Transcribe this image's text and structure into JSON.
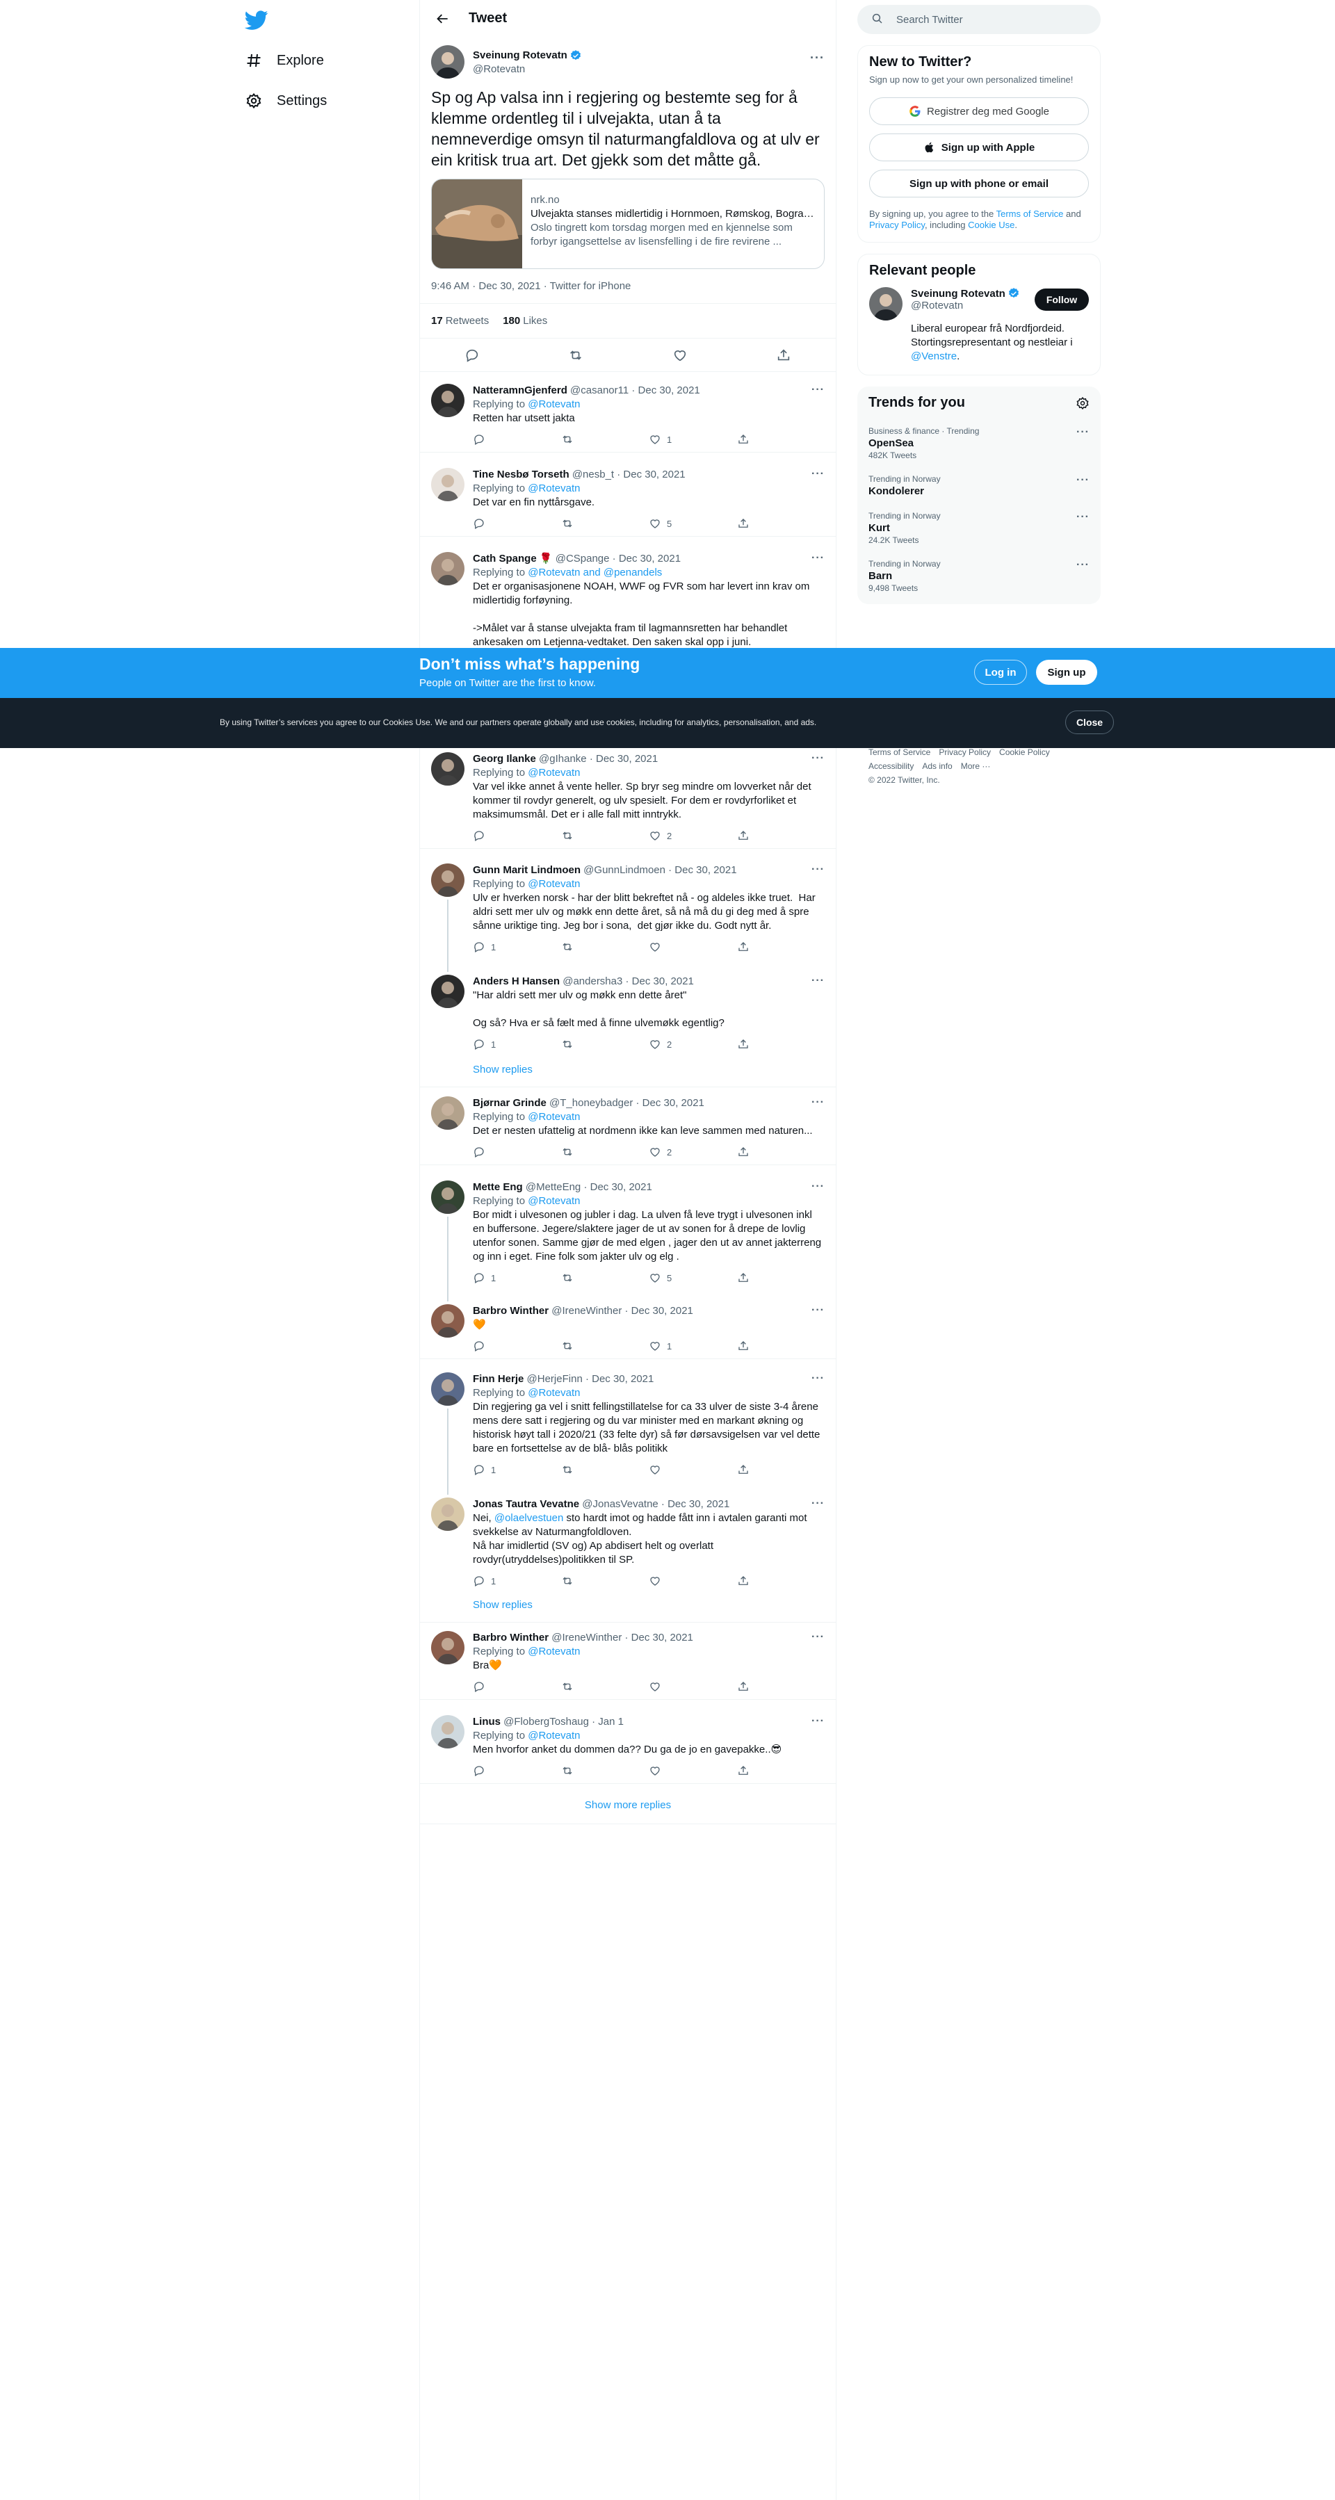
{
  "nav": {
    "explore": "Explore",
    "settings": "Settings"
  },
  "header": {
    "title": "Tweet"
  },
  "tweet": {
    "author_name": "Sveinung Rotevatn",
    "author_handle": "@Rotevatn",
    "text": "Sp og Ap valsa inn i regjering og bestemte seg for å klemme ordentleg til i ulvejakta, utan å ta nemneverdige omsyn til naturmangfaldlova og at ulv er ein kritisk trua art. Det gjekk som det måtte gå.",
    "card": {
      "domain": "nrk.no",
      "title": "Ulvejakta stanses midlertidig i Hornmoen, Rømskog, Bogran...",
      "description": "Oslo tingrett kom torsdag morgen med en kjennelse som forbyr igangsettelse av lisensfelling i de fire revirene ..."
    },
    "meta": "9:46 AM · Dec 30, 2021 · Twitter for iPhone",
    "retweets_count": "17",
    "retweets_label": "Retweets",
    "likes_count": "180",
    "likes_label": "Likes"
  },
  "replies": [
    {
      "name": "NatteramnGjenferd",
      "handle": "@casanor11 · Dec 30, 2021",
      "replying": "@Rotevatn",
      "text": "Retten har utsett jakta",
      "reply_count": "",
      "retweet_count": "",
      "like_count": "1"
    },
    {
      "name": "Tine Nesbø Torseth",
      "handle": "@nesb_t · Dec 30, 2021",
      "replying": "@Rotevatn",
      "text": "Det var en fin nyttårsgave.",
      "reply_count": "",
      "retweet_count": "",
      "like_count": "5"
    },
    {
      "name": "Cath Spange",
      "emoji": "🌹",
      "handle": "@CSpange · Dec 30, 2021",
      "replying": "@Rotevatn and @penandels",
      "text": "Det er organisasjonene NOAH, WWF og FVR som har levert inn krav om midlertidig forføyning.\n\n->Målet var å stanse ulvejakta fram til lagmannsretten har behandlet ankesaken om Letjenna-vedtaket. Den saken skal opp i juni."
    },
    {
      "name": "Georg Ilanke",
      "handle": "@gIhanke · Dec 30, 2021",
      "replying": "@Rotevatn",
      "text": "Var vel ikke annet å vente heller. Sp bryr seg mindre om lovverket når det kommer til rovdyr generelt, og ulv spesielt. For dem er rovdyrforliket et maksimumsmål. Det er i alle fall mitt inntrykk.",
      "reply_count": "",
      "retweet_count": "",
      "like_count": "2"
    },
    {
      "name": "Gunn Marit Lindmoen",
      "handle": "@GunnLindmoen · Dec 30, 2021",
      "replying": "@Rotevatn",
      "text": "Ulv er hverken norsk - har der blitt bekreftet nå - og aldeles ikke truet.  Har aldri sett mer ulv og møkk enn dette året, så nå må du gi deg med å spre sånne uriktige ting. Jeg bor i sona,  det gjør ikke du. Godt nytt år.",
      "reply_count": "1",
      "retweet_count": "",
      "like_count": ""
    },
    {
      "name": "Anders H Hansen",
      "handle": "@andersha3 · Dec 30, 2021",
      "text": "\"Har aldri sett mer ulv og møkk enn dette året\"\n\nOg så? Hva er så fælt med å finne ulvemøkk egentlig?",
      "reply_count": "1",
      "retweet_count": "",
      "like_count": "2"
    },
    {
      "name": "Bjørnar Grinde",
      "handle": "@T_honeybadger · Dec 30, 2021",
      "replying": "@Rotevatn",
      "text": "Det er nesten ufattelig at nordmenn ikke kan leve sammen med naturen...",
      "reply_count": "",
      "retweet_count": "",
      "like_count": "2"
    },
    {
      "name": "Mette Eng",
      "handle": "@MetteEng · Dec 30, 2021",
      "replying": "@Rotevatn",
      "text": "Bor midt i ulvesonen og jubler i dag. La ulven få leve trygt i ulvesonen inkl en buffersone. Jegere/slaktere jager de ut av sonen for å drepe de lovlig utenfor sonen. Samme gjør de med elgen , jager den ut av annet jakterreng og inn i eget. Fine folk som jakter ulv og elg .",
      "reply_count": "1",
      "retweet_count": "",
      "like_count": "5"
    },
    {
      "name": "Barbro Winther",
      "handle": "@IreneWinther · Dec 30, 2021",
      "text": "🧡",
      "reply_count": "",
      "retweet_count": "",
      "like_count": "1"
    },
    {
      "name": "Finn Herje",
      "handle": "@HerjeFinn · Dec 30, 2021",
      "replying": "@Rotevatn",
      "text": "Din regjering ga vel i snitt fellingstillatelse for ca 33 ulver de siste 3-4 årene mens dere satt i regjering og du var minister med en markant økning og historisk høyt tall i 2020/21 (33 felte dyr) så før dørsavsigelsen var vel dette bare en fortsettelse av de blå- blås politikk",
      "reply_count": "1",
      "retweet_count": "",
      "like_count": ""
    },
    {
      "name": "Jonas Tautra Vevatne",
      "handle": "@JonasVevatne · Dec 30, 2021",
      "mention": "@olaelvestuen",
      "text_after_mention": " sto hardt imot og hadde fått inn i avtalen garanti mot svekkelse av Naturmangfoldloven.\nNå har imidlertid (SV og) Ap abdisert helt og overlatt rovdyr(utryddelses)politikken til SP.",
      "reply_count": "1",
      "retweet_count": "",
      "like_count": ""
    },
    {
      "name": "Barbro Winther",
      "handle": "@IreneWinther · Dec 30, 2021",
      "replying": "@Rotevatn",
      "text": "Bra🧡",
      "reply_count": "",
      "retweet_count": "",
      "like_count": ""
    },
    {
      "name": "Linus",
      "handle": "@FlobergToshaug · Jan 1",
      "replying": "@Rotevatn",
      "text": "Men hvorfor anket du dommen da?? Du ga de jo en gavepakke..😎",
      "reply_count": "",
      "retweet_count": "",
      "like_count": ""
    }
  ],
  "replying_to_label": "Replying to",
  "show_replies": "Show replies",
  "show_more_replies": "Show more replies",
  "search": {
    "placeholder": "Search Twitter"
  },
  "new_to_twitter": {
    "title": "New to Twitter?",
    "subtitle": "Sign up now to get your own personalized timeline!",
    "google": "Registrer deg med Google",
    "apple": "Sign up with Apple",
    "phone": "Sign up with phone or email",
    "terms_1": "By signing up, you agree to the ",
    "terms_link1": "Terms of Service",
    "terms_2": " and ",
    "terms_link2": "Privacy Policy",
    "terms_3": ", including ",
    "terms_link3": "Cookie Use",
    "terms_4": "."
  },
  "relevant": {
    "title": "Relevant people",
    "name": "Sveinung Rotevatn",
    "handle": "@Rotevatn",
    "follow": "Follow",
    "bio": "Liberal europear frå Nordfjordeid. Stortingsrepresentant og nestleiar i ",
    "bio_link": "@Venstre",
    "bio_end": "."
  },
  "trends": {
    "title": "Trends for you",
    "items": [
      {
        "context": "Business & finance · Trending",
        "name": "OpenSea",
        "count": "482K Tweets"
      },
      {
        "context": "Trending in Norway",
        "name": "Kondolerer",
        "count": ""
      },
      {
        "context": "Trending in Norway",
        "name": "Kurt",
        "count": "24.2K Tweets"
      },
      {
        "context": "Trending in Norway",
        "name": "Barn",
        "count": "9,498 Tweets"
      }
    ]
  },
  "footer": {
    "links": [
      "Terms of Service",
      "Privacy Policy",
      "Cookie Policy",
      "Accessibility",
      "Ads info",
      "More ···"
    ],
    "copyright": "© 2022 Twitter, Inc."
  },
  "signup_bar": {
    "title": "Don’t miss what’s happening",
    "subtitle": "People on Twitter are the first to know.",
    "login": "Log in",
    "signup": "Sign up"
  },
  "cookie_bar": {
    "text": "By using Twitter’s services you agree to our Cookies Use. We and our partners operate globally and use cookies, including for analytics, personalisation, and ads.",
    "close": "Close"
  },
  "colors": {
    "accent": "#1d9bf0",
    "text": "#0f1419",
    "secondary": "#536471",
    "cookie_bg": "#15202b"
  }
}
